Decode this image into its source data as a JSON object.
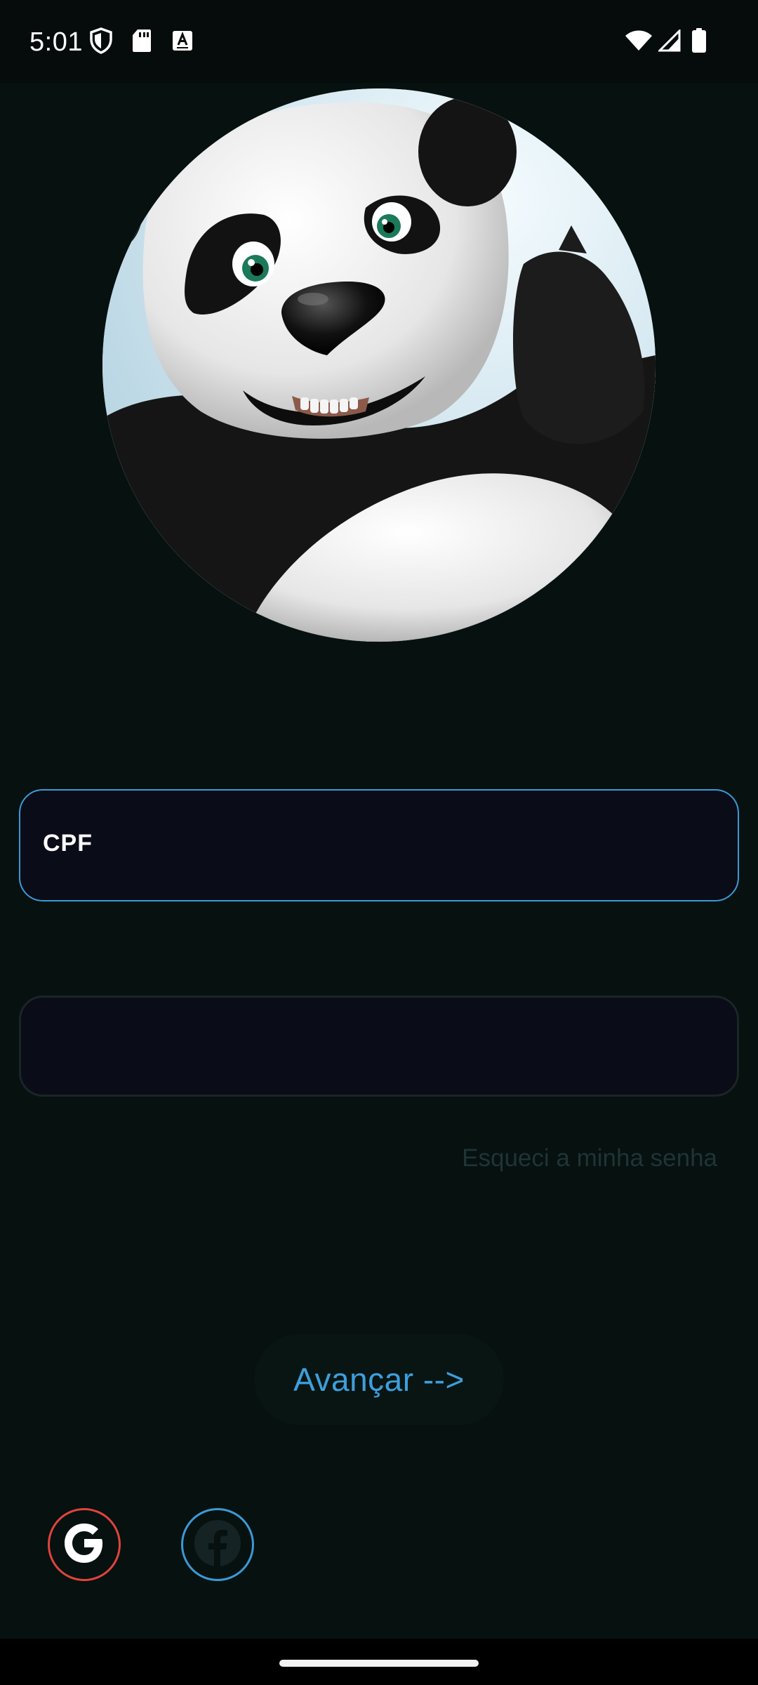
{
  "status_bar": {
    "time": "5:01",
    "left_icons": [
      "shield-icon",
      "sd-card-icon",
      "font-a-icon"
    ],
    "right_icons": [
      "wifi-icon",
      "signal-icon",
      "battery-icon"
    ]
  },
  "avatar": {
    "icon": "panda-avatar"
  },
  "login_form": {
    "cpf_label": "CPF",
    "password_value": "",
    "forgot_password": "Esqueci a minha senha",
    "next_button": "Avançar -->"
  },
  "social_login": {
    "google_icon": "google-icon",
    "facebook_icon": "facebook-icon"
  },
  "colors": {
    "background": "#061110",
    "accent": "#3a9ad6",
    "google_ring": "#e0443a",
    "field_background": "#0a0c18",
    "link_muted": "#1f3436"
  }
}
